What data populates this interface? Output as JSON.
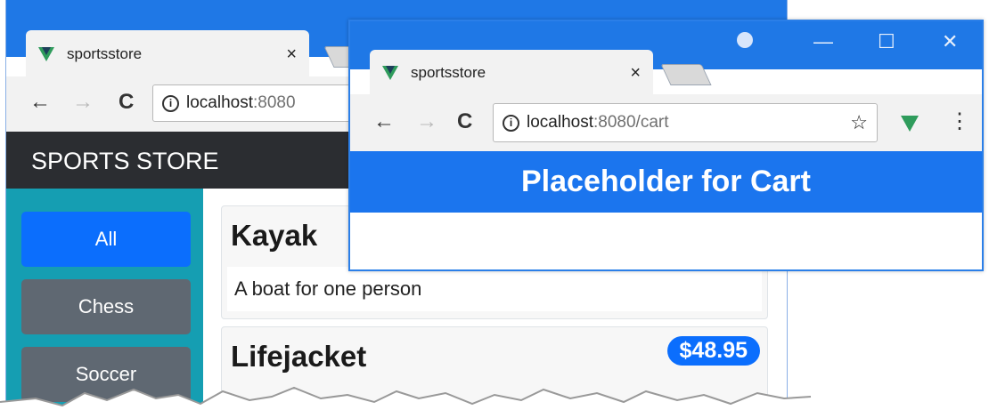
{
  "back_window": {
    "tab_title": "sportsstore",
    "tab_close": "×",
    "url_host": "localhost",
    "url_rest": ":8080",
    "nav_back": "←",
    "nav_forward": "→",
    "nav_reload": "C",
    "brand": "SPORTS STORE",
    "categories": [
      {
        "label": "All",
        "active": true
      },
      {
        "label": "Chess",
        "active": false
      },
      {
        "label": "Soccer",
        "active": false
      }
    ],
    "products": [
      {
        "name": "Kayak",
        "description": "A boat for one person"
      },
      {
        "name": "Lifejacket",
        "price": "$48.95"
      }
    ]
  },
  "front_window": {
    "tab_title": "sportsstore",
    "tab_close": "×",
    "url_host": "localhost",
    "url_rest": ":8080/cart",
    "nav_back": "←",
    "nav_forward": "→",
    "nav_reload": "C",
    "bookmark_star": "☆",
    "menu_dots": "⋮",
    "minimize": "—",
    "maximize": "☐",
    "close": "✕",
    "heading": "Placeholder for Cart"
  },
  "colors": {
    "chrome_blue": "#1f78e6",
    "active_category": "#0b6efd",
    "sidebar": "#159eb2",
    "brand_bar": "#2b2d31"
  }
}
